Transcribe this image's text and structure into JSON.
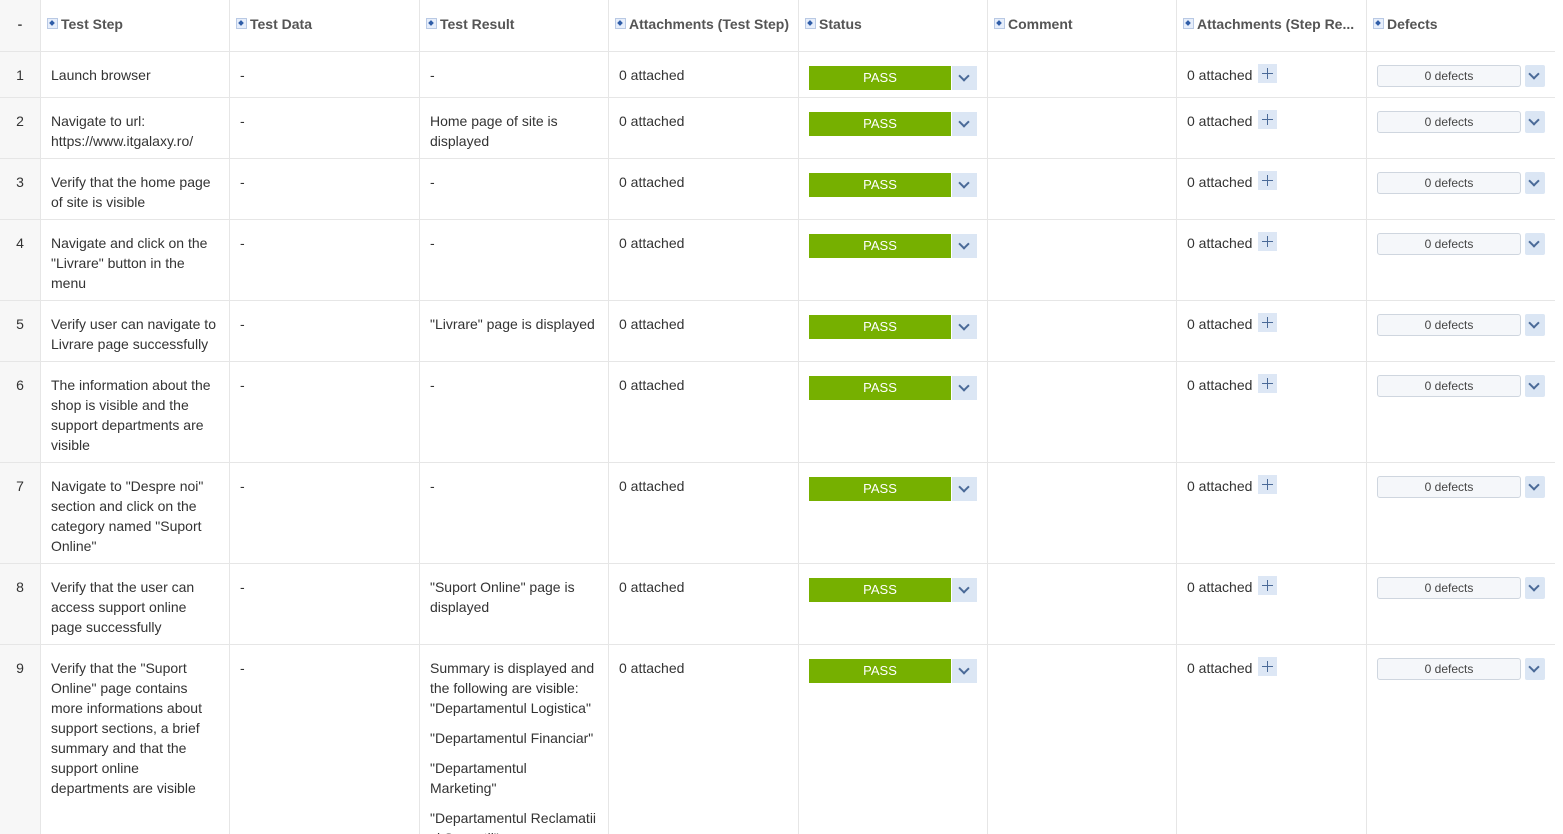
{
  "headers": {
    "index": "-",
    "test_step": "Test Step",
    "test_data": "Test Data",
    "test_result": "Test Result",
    "attachments_test_step": "Attachments (Test Step)",
    "status": "Status",
    "comment": "Comment",
    "attachments_step_result": "Attachments (Step Re...",
    "defects": "Defects"
  },
  "colors": {
    "pass": "#76b000",
    "dropdown": "#dbe6f4"
  },
  "rows": [
    {
      "index": "1",
      "test_step": [
        "Launch browser"
      ],
      "test_data": "-",
      "test_result": [
        "-"
      ],
      "attachments": "0 attached",
      "status": "PASS",
      "comment": "",
      "step_attachments": "0 attached",
      "defects": "0 defects"
    },
    {
      "index": "2",
      "test_step": [
        "Navigate to url:",
        "https://www.itgalaxy.ro/"
      ],
      "test_data": "-",
      "test_result": [
        "Home page of site is",
        "displayed"
      ],
      "attachments": "0 attached",
      "status": "PASS",
      "comment": "",
      "step_attachments": "0 attached",
      "defects": "0 defects"
    },
    {
      "index": "3",
      "test_step": [
        "Verify that the home page",
        "of site is visible"
      ],
      "test_data": "-",
      "test_result": [
        "-"
      ],
      "attachments": "0 attached",
      "status": "PASS",
      "comment": "",
      "step_attachments": "0 attached",
      "defects": "0 defects"
    },
    {
      "index": "4",
      "test_step": [
        "Navigate and click on the",
        "\"Livrare\" button in the",
        "menu"
      ],
      "test_data": "-",
      "test_result": [
        "-"
      ],
      "attachments": "0 attached",
      "status": "PASS",
      "comment": "",
      "step_attachments": "0 attached",
      "defects": "0 defects"
    },
    {
      "index": "5",
      "test_step": [
        "Verify user can navigate to",
        "Livrare page successfully"
      ],
      "test_data": "-",
      "test_result": [
        "\"Livrare\" page is displayed"
      ],
      "attachments": "0 attached",
      "status": "PASS",
      "comment": "",
      "step_attachments": "0 attached",
      "defects": "0 defects"
    },
    {
      "index": "6",
      "test_step": [
        "The information about the",
        "shop is visible and the",
        "support departments are",
        "visible"
      ],
      "test_data": "-",
      "test_result": [
        "-"
      ],
      "attachments": "0 attached",
      "status": "PASS",
      "comment": "",
      "step_attachments": "0 attached",
      "defects": "0 defects"
    },
    {
      "index": "7",
      "test_step": [
        "Navigate to \"Despre noi\"",
        "section and click on the",
        "category named \"Suport",
        "Online\""
      ],
      "test_data": "-",
      "test_result": [
        "-"
      ],
      "attachments": "0 attached",
      "status": "PASS",
      "comment": "",
      "step_attachments": "0 attached",
      "defects": "0 defects"
    },
    {
      "index": "8",
      "test_step": [
        "Verify that the user can",
        "access support online",
        "page successfully"
      ],
      "test_data": "-",
      "test_result": [
        "\"Suport Online\" page is",
        "displayed"
      ],
      "attachments": "0 attached",
      "status": "PASS",
      "comment": "",
      "step_attachments": "0 attached",
      "defects": "0 defects"
    },
    {
      "index": "9",
      "test_step": [
        "Verify that the \"Suport",
        "Online\" page contains",
        "more informations about",
        "support sections, a brief",
        "summary and that the",
        "support online",
        "departments are visible"
      ],
      "test_data": "-",
      "test_result_paragraphs": [
        [
          "Summary is displayed and",
          "the following are visible:",
          "\"Departamentul Logistica\""
        ],
        [
          "\"Departamentul Financiar\""
        ],
        [
          "\"Departamentul",
          "Marketing\""
        ],
        [
          "\"Departamentul Reclamatii",
          "si Sugestii\""
        ]
      ],
      "attachments": "0 attached",
      "status": "PASS",
      "comment": "",
      "step_attachments": "0 attached",
      "defects": "0 defects"
    }
  ]
}
